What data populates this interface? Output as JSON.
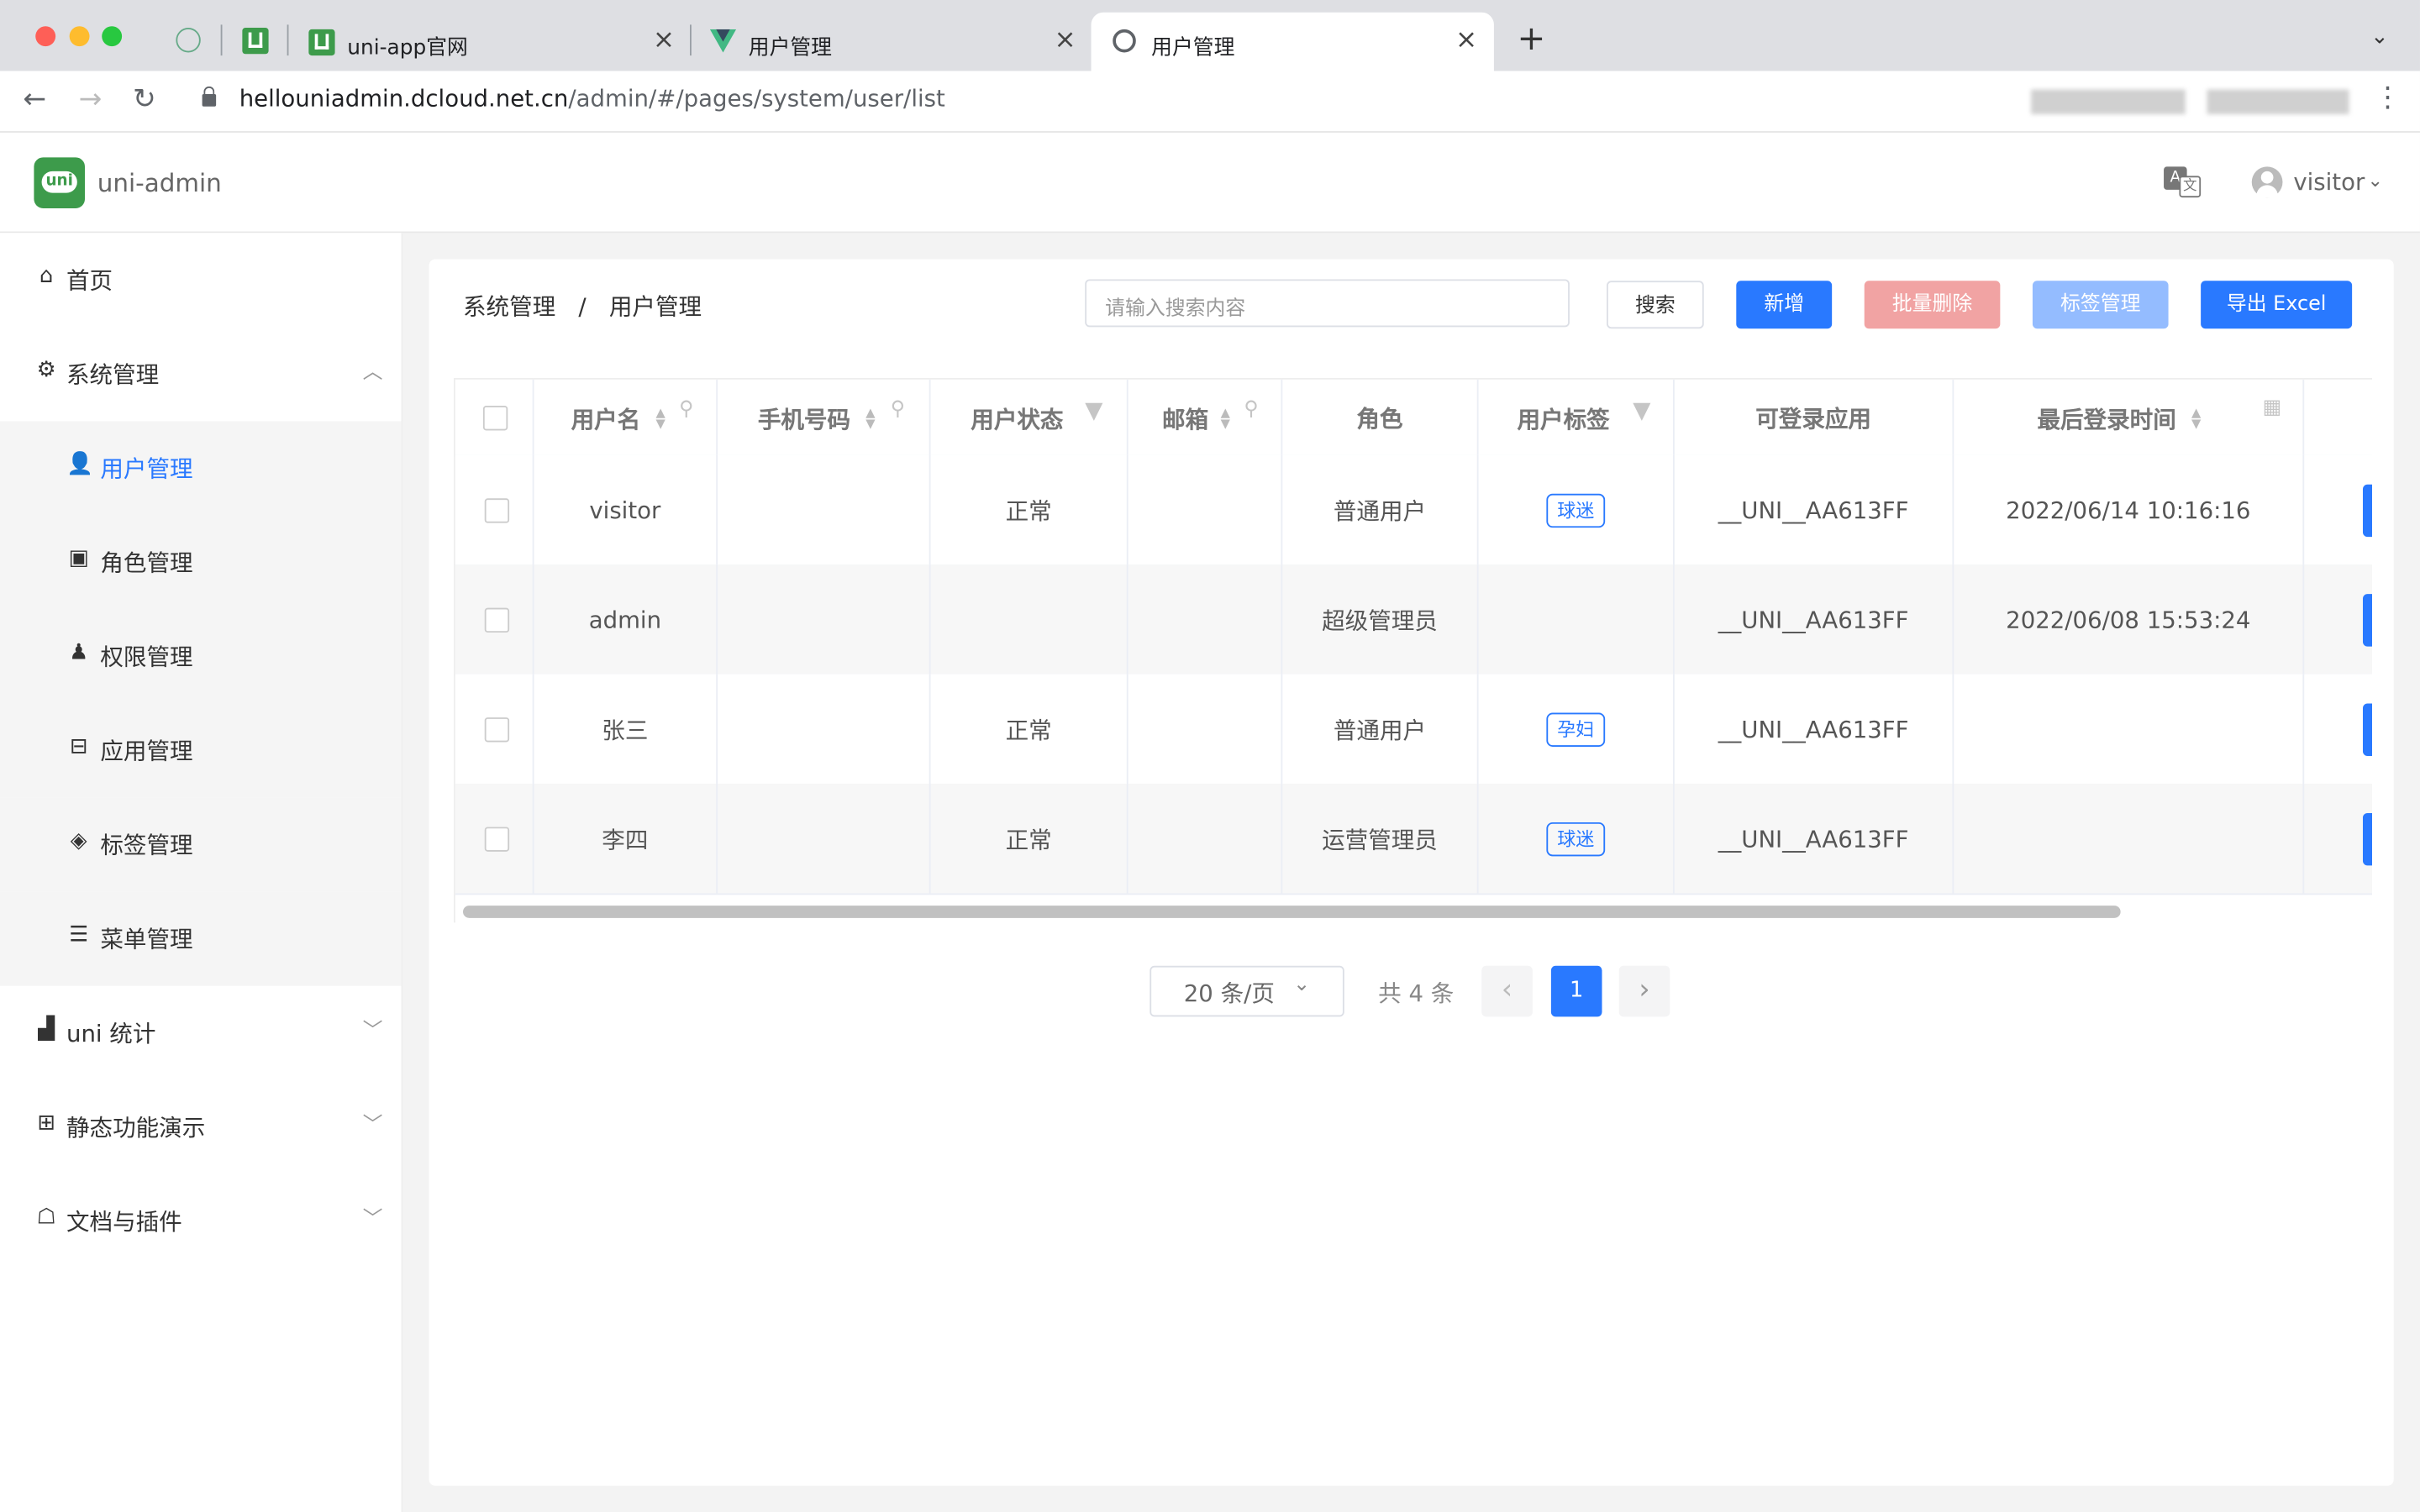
{
  "browser": {
    "tabs": [
      {
        "title": "uni-app官网"
      },
      {
        "title": "用户管理"
      },
      {
        "title": "用户管理"
      }
    ],
    "url_host": "hellouniadmin.dcloud.net.cn",
    "url_path": "/admin/#/pages/system/user/list"
  },
  "header": {
    "logo_text": "uni",
    "brand": "uni-admin",
    "user": "visitor"
  },
  "sidebar": {
    "items": [
      {
        "label": "首页"
      },
      {
        "label": "系统管理"
      },
      {
        "label": "用户管理"
      },
      {
        "label": "角色管理"
      },
      {
        "label": "权限管理"
      },
      {
        "label": "应用管理"
      },
      {
        "label": "标签管理"
      },
      {
        "label": "菜单管理"
      },
      {
        "label": "uni 统计"
      },
      {
        "label": "静态功能演示"
      },
      {
        "label": "文档与插件"
      }
    ]
  },
  "breadcrumb": {
    "parent": "系统管理",
    "separator": "/",
    "current": "用户管理"
  },
  "toolbar": {
    "search_placeholder": "请输入搜索内容",
    "search_label": "搜索",
    "add_label": "新增",
    "batch_delete_label": "批量删除",
    "tag_manage_label": "标签管理",
    "export_label": "导出 Excel"
  },
  "table": {
    "columns": [
      "用户名",
      "手机号码",
      "用户状态",
      "邮箱",
      "角色",
      "用户标签",
      "可登录应用",
      "最后登录时间"
    ],
    "rows": [
      {
        "username": "visitor",
        "mobile": "",
        "status": "正常",
        "email": "",
        "role": "普通用户",
        "tag": "球迷",
        "app": "__UNI__AA613FF",
        "last_login": "2022/06/14 10:16:16"
      },
      {
        "username": "admin",
        "mobile": "",
        "status": "",
        "email": "",
        "role": "超级管理员",
        "tag": "",
        "app": "__UNI__AA613FF",
        "last_login": "2022/06/08 15:53:24"
      },
      {
        "username": "张三",
        "mobile": "",
        "status": "正常",
        "email": "",
        "role": "普通用户",
        "tag": "孕妇",
        "app": "__UNI__AA613FF",
        "last_login": ""
      },
      {
        "username": "李四",
        "mobile": "",
        "status": "正常",
        "email": "",
        "role": "运营管理员",
        "tag": "球迷",
        "app": "__UNI__AA613FF",
        "last_login": ""
      }
    ]
  },
  "pagination": {
    "page_size": "20 条/页",
    "total": "共 4 条",
    "current_page": "1"
  },
  "colors": {
    "primary": "#2979ff",
    "danger_disabled": "#f1a3a3",
    "primary_disabled": "#94bcff",
    "brand_green": "#3d9b4b"
  }
}
